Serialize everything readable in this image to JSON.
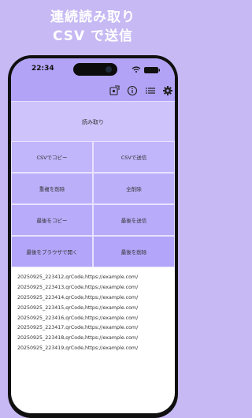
{
  "hero": {
    "line1": "連続読み取り",
    "line2": "CSV で送信"
  },
  "status": {
    "time": "22:34"
  },
  "toolbar": {
    "icons": [
      "settings-export-icon",
      "info-icon",
      "list-icon",
      "gear-icon"
    ]
  },
  "actions": {
    "read": "読み取り",
    "grid": [
      [
        "CSVでコピー",
        "CSVで送信"
      ],
      [
        "重複を削除",
        "全削除"
      ],
      [
        "最後をコピー",
        "最後を送信"
      ],
      [
        "最後をブラウザで開く",
        "最後を削除"
      ]
    ]
  },
  "results": [
    "20250925_223412,qrCode,https://example.com/",
    "20250925_223413,qrCode,https://example.com/",
    "20250925_223414,qrCode,https://example.com/",
    "20250925_223415,qrCode,https://example.com/",
    "20250925_223416,qrCode,https://example.com/",
    "20250925_223417,qrCode,https://example.com/",
    "20250925_223418,qrCode,https://example.com/",
    "20250925_223419,qrCode,https://example.com/"
  ],
  "colors": {
    "background": "#c7b9f3",
    "toolbar": "#b2a3f6",
    "button": "#c1b5fb"
  }
}
